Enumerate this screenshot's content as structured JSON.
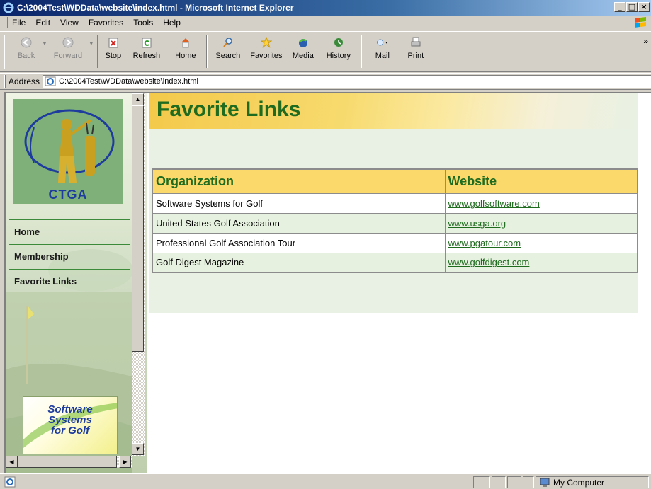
{
  "window": {
    "title": "C:\\2004Test\\WDData\\website\\index.html - Microsoft Internet Explorer",
    "controls": [
      "minimize",
      "maximize",
      "close"
    ]
  },
  "menubar": {
    "items": [
      "File",
      "Edit",
      "View",
      "Favorites",
      "Tools",
      "Help"
    ]
  },
  "toolbar": {
    "buttons": [
      {
        "label": "Back",
        "icon": "back-arrow-icon",
        "enabled": false
      },
      {
        "label": "Forward",
        "icon": "forward-arrow-icon",
        "enabled": false
      },
      {
        "label": "Stop",
        "icon": "stop-icon",
        "enabled": true
      },
      {
        "label": "Refresh",
        "icon": "refresh-icon",
        "enabled": true
      },
      {
        "label": "Home",
        "icon": "home-icon",
        "enabled": true
      },
      {
        "label": "Search",
        "icon": "search-icon",
        "enabled": true
      },
      {
        "label": "Favorites",
        "icon": "star-icon",
        "enabled": true
      },
      {
        "label": "Media",
        "icon": "media-icon",
        "enabled": true
      },
      {
        "label": "History",
        "icon": "history-icon",
        "enabled": true
      },
      {
        "label": "Mail",
        "icon": "mail-icon",
        "enabled": true
      },
      {
        "label": "Print",
        "icon": "printer-icon",
        "enabled": true
      }
    ],
    "more": "»"
  },
  "address": {
    "label": "Address",
    "value": "C:\\2004Test\\WDData\\website\\index.html"
  },
  "sidebar": {
    "logo_text": "CTGA",
    "nav": [
      "Home",
      "Membership",
      "Favorite Links"
    ],
    "sponsor_text": [
      "Software",
      "Systems",
      "for Golf"
    ]
  },
  "page": {
    "heading": "Favorite Links",
    "table": {
      "headers": [
        "Organization",
        "Website"
      ],
      "rows": [
        [
          "Software Systems for Golf",
          "www.golfsoftware.com"
        ],
        [
          "United States Golf Association",
          "www.usga.org"
        ],
        [
          "Professional Golf Association Tour",
          "www.pgatour.com"
        ],
        [
          "Golf Digest Magazine",
          "www.golfdigest.com"
        ]
      ]
    }
  },
  "statusbar": {
    "zone": "My Computer"
  },
  "colors": {
    "heading_green": "#1f6b1f",
    "header_yellow": "#fbd96a",
    "row_alt": "#e6f1df",
    "titlebar_blue": "#0a246a"
  }
}
